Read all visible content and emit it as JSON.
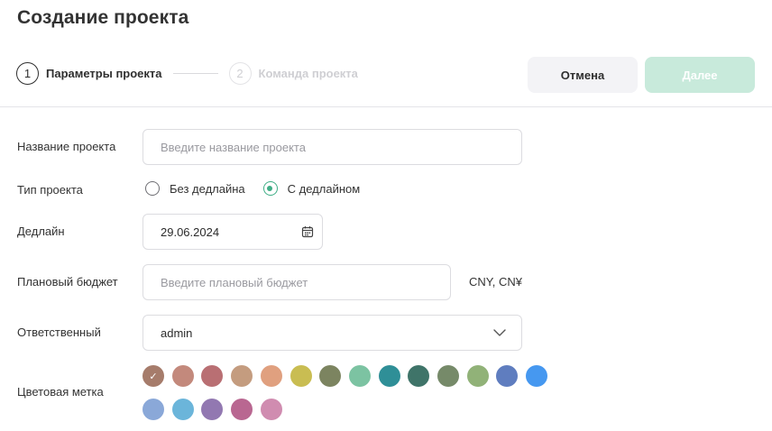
{
  "page": {
    "title": "Создание проекта"
  },
  "stepper": {
    "steps": [
      {
        "number": "1",
        "label": "Параметры проекта",
        "active": true
      },
      {
        "number": "2",
        "label": "Команда проекта",
        "active": false
      }
    ]
  },
  "actions": {
    "cancel_label": "Отмена",
    "next_label": "Далее"
  },
  "form": {
    "name": {
      "label": "Название проекта",
      "placeholder": "Введите название проекта"
    },
    "type": {
      "label": "Тип проекта",
      "options": [
        {
          "label": "Без дедлайна",
          "checked": false
        },
        {
          "label": "С дедлайном",
          "checked": true
        }
      ]
    },
    "deadline": {
      "label": "Дедлайн",
      "value": "29.06.2024",
      "icon": "calendar-icon"
    },
    "budget": {
      "label": "Плановый бюджет",
      "placeholder": "Введите плановый бюджет",
      "currency": "CNY, CN¥"
    },
    "owner": {
      "label": "Ответственный",
      "value": "admin",
      "icon": "chevron-down-icon"
    },
    "color": {
      "label": "Цветовая метка",
      "selected_index": 0,
      "swatches": [
        "#a67c6b",
        "#c3897c",
        "#b96f73",
        "#c49c7f",
        "#e0a07f",
        "#c9bd52",
        "#7c8460",
        "#7cc3a2",
        "#2f8f97",
        "#3f7469",
        "#768a69",
        "#91b278",
        "#5f7dbf",
        "#4698f0",
        "#8aa8d8",
        "#6bb5da",
        "#9278b1",
        "#b96791",
        "#d08cb0"
      ]
    }
  },
  "colors": {
    "accent": "#3fae86",
    "next_button_bg": "#c8eadb",
    "cancel_button_bg": "#f3f3f6"
  }
}
